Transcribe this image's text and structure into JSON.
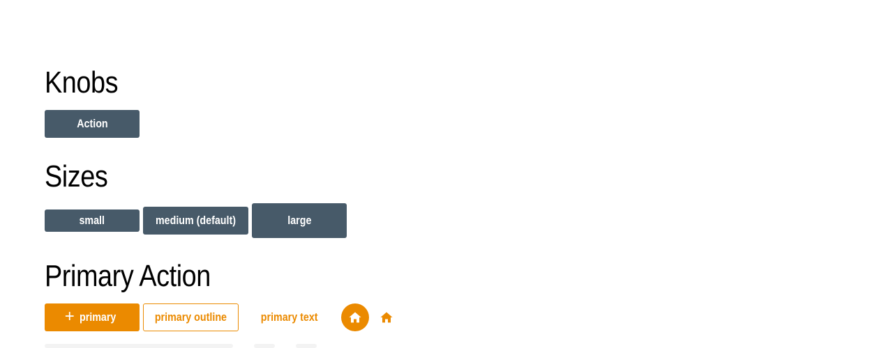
{
  "sections": {
    "knobs": {
      "title": "Knobs",
      "action_label": "Action"
    },
    "sizes": {
      "title": "Sizes",
      "small_label": "small",
      "medium_label": "medium (default)",
      "large_label": "large"
    },
    "primary_action": {
      "title": "Primary Action",
      "primary_icon": "+",
      "primary_label": "primary",
      "outline_label": "primary outline",
      "text_label": "primary text",
      "icon_circle": "home-icon",
      "icon_plain": "home-icon"
    }
  },
  "colors": {
    "dark_button": "#475a69",
    "primary": "#eb8a00",
    "text": "#000000",
    "background": "#ffffff"
  }
}
